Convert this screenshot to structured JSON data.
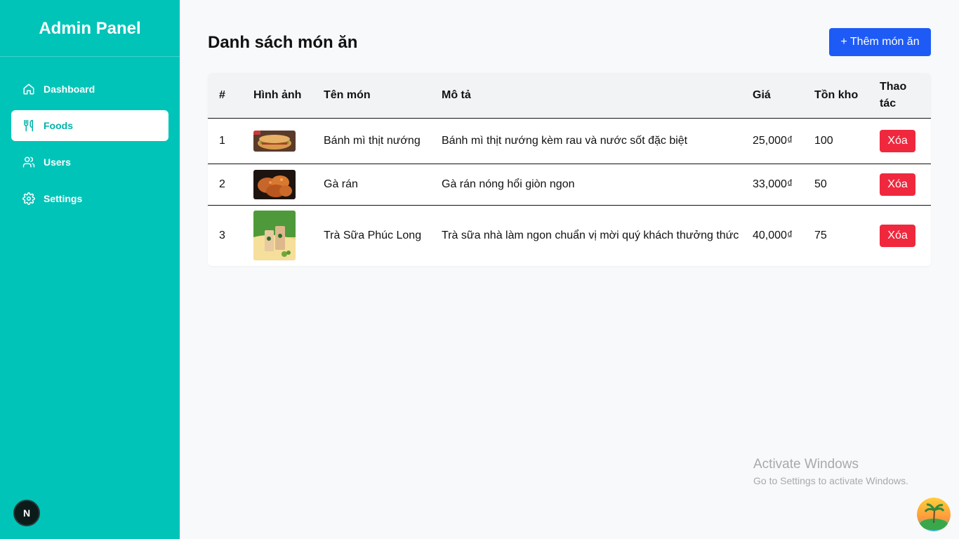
{
  "sidebar": {
    "title": "Admin Panel",
    "items": [
      {
        "label": "Dashboard",
        "icon": "home-icon"
      },
      {
        "label": "Foods",
        "icon": "utensils-icon",
        "active": true
      },
      {
        "label": "Users",
        "icon": "users-icon"
      },
      {
        "label": "Settings",
        "icon": "gear-icon"
      }
    ],
    "badge": "N"
  },
  "header": {
    "title": "Danh sách món ăn",
    "add_button": "+ Thêm món ăn"
  },
  "table": {
    "columns": [
      "#",
      "Hình ảnh",
      "Tên món",
      "Mô tả",
      "Giá",
      "Tồn kho",
      "Thao tác"
    ],
    "rows": [
      {
        "index": "1",
        "name": "Bánh mì thịt nướng",
        "description": "Bánh mì thịt nướng kèm rau và nước sốt đặc biệt",
        "price": "25,000₫",
        "stock": "100",
        "action": "Xóa"
      },
      {
        "index": "2",
        "name": "Gà rán",
        "description": "Gà rán nóng hổi giòn ngon",
        "price": "33,000₫",
        "stock": "50",
        "action": "Xóa"
      },
      {
        "index": "3",
        "name": "Trà Sữa Phúc Long",
        "description": "Trà sữa nhà làm ngon chuẩn vị mời quý khách thưởng thức",
        "price": "40,000₫",
        "stock": "75",
        "action": "Xóa"
      }
    ]
  },
  "watermark": {
    "title": "Activate Windows",
    "subtitle": "Go to Settings to activate Windows."
  },
  "colors": {
    "sidebar": "#00c4b8",
    "primary_button": "#1e5bf6",
    "danger_button": "#f0283e"
  }
}
